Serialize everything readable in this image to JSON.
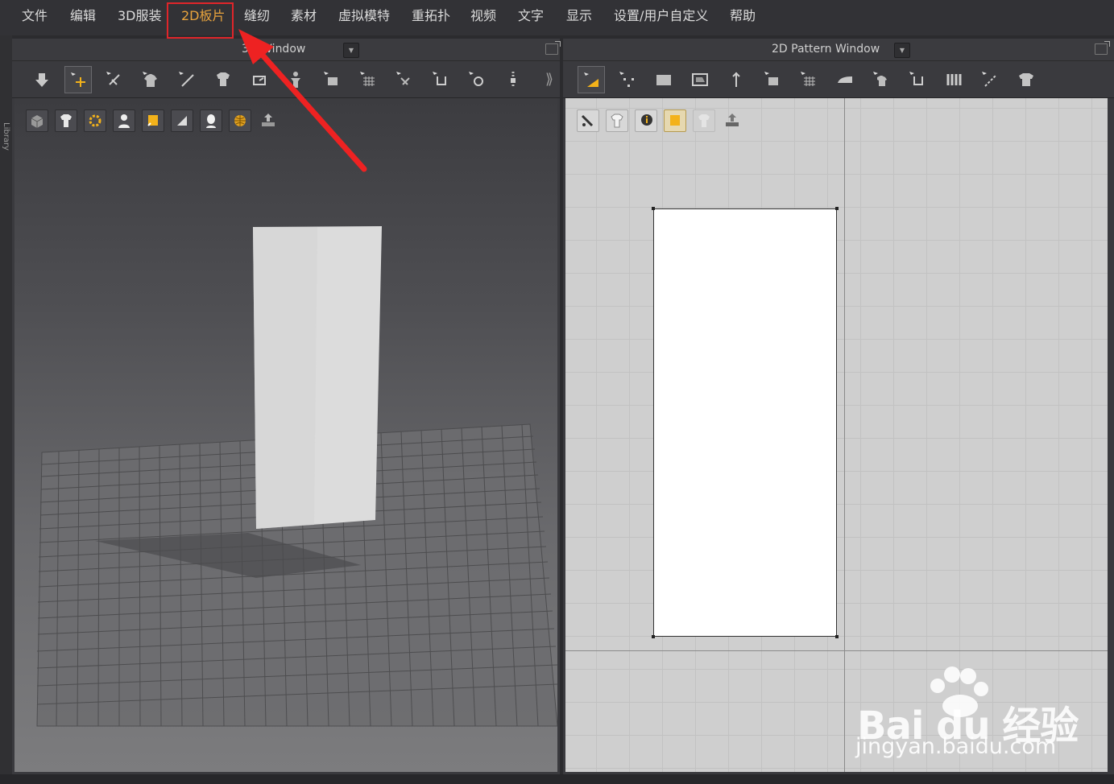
{
  "menu": {
    "items": [
      {
        "label": "文件"
      },
      {
        "label": "编辑"
      },
      {
        "label": "3D服装"
      },
      {
        "label": "2D板片",
        "active": true
      },
      {
        "label": "缝纫"
      },
      {
        "label": "素材"
      },
      {
        "label": "虚拟模特"
      },
      {
        "label": "重拓扑"
      },
      {
        "label": "视频"
      },
      {
        "label": "文字"
      },
      {
        "label": "显示"
      },
      {
        "label": "设置/用户自定义"
      },
      {
        "label": "帮助"
      }
    ]
  },
  "library": {
    "label": "Library"
  },
  "window3d": {
    "title": "3D Window",
    "toolbar_overflow": "⟫"
  },
  "window2d": {
    "title": "2D Pattern Window"
  },
  "colors": {
    "highlight": "#e0252a",
    "active_menu": "#e8a33d",
    "accent": "#f3b21a"
  },
  "watermark": {
    "brand": "Bai du 经验",
    "url": "jingyan.baidu.com"
  }
}
